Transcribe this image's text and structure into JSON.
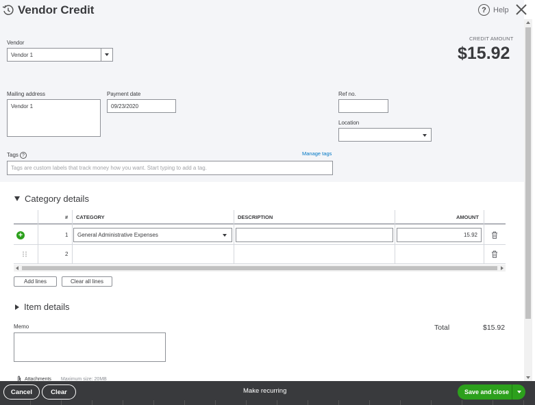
{
  "header": {
    "title": "Vendor Credit",
    "help_label": "Help"
  },
  "form": {
    "vendor_label": "Vendor",
    "vendor_value": "Vendor 1",
    "credit_amount_label": "CREDIT AMOUNT",
    "credit_amount_value": "$15.92",
    "mailing_address_label": "Mailing address",
    "mailing_address_value": "Vendor 1",
    "payment_date_label": "Payment date",
    "payment_date_value": "09/23/2020",
    "ref_no_label": "Ref no.",
    "ref_no_value": "",
    "location_label": "Location",
    "location_value": "",
    "tags_label": "Tags",
    "manage_tags_label": "Manage tags",
    "tags_placeholder": "Tags are custom labels that track money how you want. Start typing to add a tag."
  },
  "category_details": {
    "title": "Category details",
    "columns": [
      "#",
      "CATEGORY",
      "DESCRIPTION",
      "AMOUNT"
    ],
    "rows": [
      {
        "num": "1",
        "category": "General Administrative Expenses",
        "description": "",
        "amount": "15.92"
      },
      {
        "num": "2",
        "category": "",
        "description": "",
        "amount": ""
      }
    ],
    "add_lines_label": "Add lines",
    "clear_all_lines_label": "Clear all lines"
  },
  "item_details": {
    "title": "Item details"
  },
  "memo": {
    "label": "Memo",
    "value": ""
  },
  "totals": {
    "total_label": "Total",
    "total_value": "$15.92"
  },
  "attachments": {
    "label": "Attachments",
    "max_size": "Maximum size: 20MB"
  },
  "footer": {
    "cancel_label": "Cancel",
    "clear_label": "Clear",
    "make_recurring_label": "Make recurring",
    "save_close_label": "Save and close"
  },
  "colors": {
    "accent_green": "#2ca01c",
    "link_blue": "#0077c5",
    "footer_bg": "#393a3d"
  }
}
